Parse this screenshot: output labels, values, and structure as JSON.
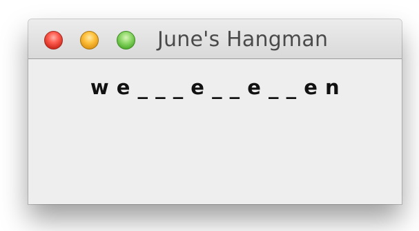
{
  "window": {
    "title": "June's Hangman"
  },
  "game": {
    "masked_word": "w e _ _ _ e _ _ e _ _ e n"
  },
  "colors": {
    "close": "#ff5f52",
    "minimize": "#ffc13d",
    "zoom": "#8fd86a",
    "content_background": "#eeeeee"
  }
}
